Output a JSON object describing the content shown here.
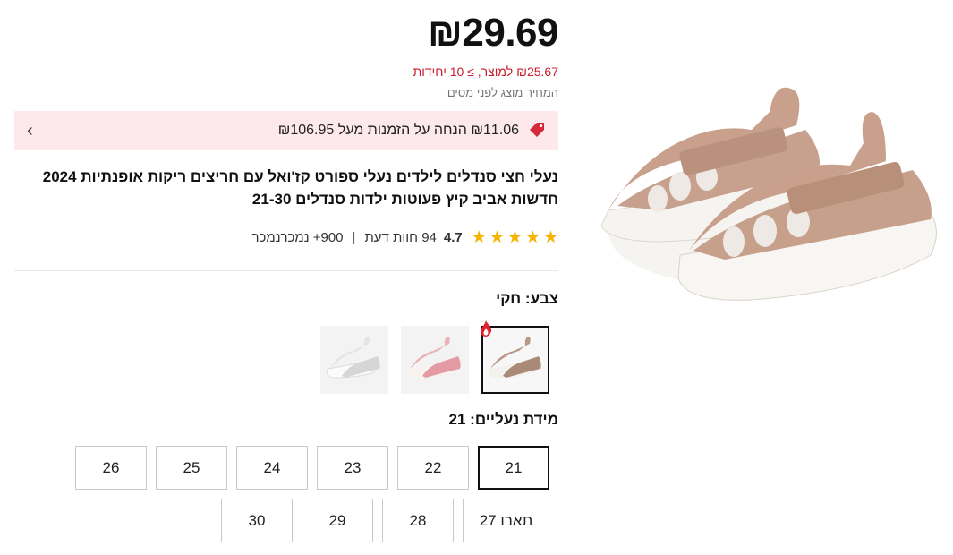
{
  "price": {
    "main": "₪29.69",
    "unit_price": "₪25.67 למוצר, ≥ 10 יחידות",
    "tax_note": "המחיר מוצג לפני מסים"
  },
  "promo": {
    "text": "₪11.06 הנחה על הזמנות מעל ₪106.95",
    "chevron": "›",
    "icon": "tag-icon",
    "background": "#fde9ec",
    "accent": "#c81e2c"
  },
  "product": {
    "title": "נעלי חצי סנדלים לילדים נעלי ספורט קז'ואל עם חריצים ריקות אופנתיות 2024 חדשות אביב קיץ פעוטות ילדות סנדלים 21-30"
  },
  "rating": {
    "stars": 5,
    "value": "4.7",
    "reviews": "94 חוות דעת",
    "sold": "900+ נמכרנמכר",
    "star_color": "#f5b400"
  },
  "color": {
    "label": "צבע: חקי",
    "swatches": [
      {
        "name": "khaki",
        "selected": true,
        "hot": true
      },
      {
        "name": "pink",
        "selected": false,
        "hot": false
      },
      {
        "name": "white",
        "selected": false,
        "hot": false
      }
    ]
  },
  "size": {
    "label": "מידת נעליים: 21",
    "options": [
      {
        "label": "21",
        "selected": true
      },
      {
        "label": "22",
        "selected": false
      },
      {
        "label": "23",
        "selected": false
      },
      {
        "label": "24",
        "selected": false
      },
      {
        "label": "25",
        "selected": false
      },
      {
        "label": "26",
        "selected": false
      },
      {
        "label": "תארו 27",
        "selected": false
      },
      {
        "label": "28",
        "selected": false
      },
      {
        "label": "29",
        "selected": false
      },
      {
        "label": "30",
        "selected": false
      }
    ]
  }
}
